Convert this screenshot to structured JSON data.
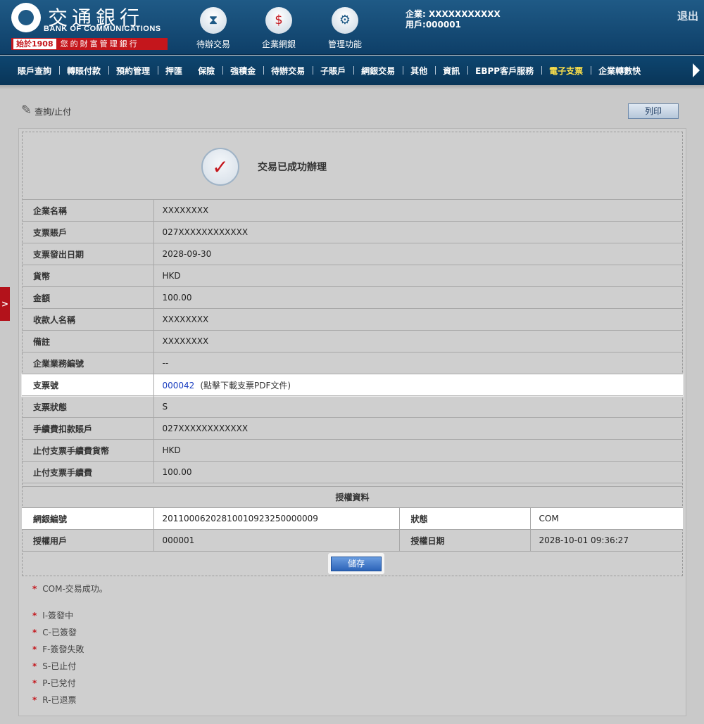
{
  "header": {
    "logo": {
      "cn": "交通銀行",
      "en": "BANK OF COMMUNICATIONS",
      "since": "始於1908",
      "slogan": "您的財富管理銀行"
    },
    "top_nav": [
      {
        "label": "待辦交易",
        "icon": "hourglass-icon"
      },
      {
        "label": "企業網銀",
        "icon": "monitor-dollar-icon"
      },
      {
        "label": "管理功能",
        "icon": "gears-icon"
      }
    ],
    "user": {
      "company_label": "企業:",
      "company": "XXXXXXXXXXX",
      "user_label": "用戶:",
      "user_id": "000001"
    },
    "logout": "退出"
  },
  "menu": {
    "items": [
      "賬戶查詢",
      "轉賬付款",
      "預約管理",
      "押匯",
      "保險",
      "強積金",
      "待辦交易",
      "子賬戶",
      "網銀交易",
      "其他",
      "資訊",
      "EBPP客戶服務",
      "電子支票",
      "企業轉數快"
    ],
    "active_index": 12,
    "active_color": "#ffe24a"
  },
  "side_tab": {
    "label": ">"
  },
  "page": {
    "title": "查詢/止付",
    "print_label": "列印",
    "success_message": "交易已成功辦理"
  },
  "details": [
    {
      "label": "企業名稱",
      "value": "XXXXXXXX"
    },
    {
      "label": "支票賬戶",
      "value": "027XXXXXXXXXXXX"
    },
    {
      "label": "支票發出日期",
      "value": "2028-09-30"
    },
    {
      "label": "貨幣",
      "value": "HKD"
    },
    {
      "label": "金額",
      "value": "100.00"
    },
    {
      "label": "收款人名稱",
      "value": "XXXXXXXX"
    },
    {
      "label": "備註",
      "value": "XXXXXXXX"
    },
    {
      "label": "企業業務編號",
      "value": "--"
    },
    {
      "label": "支票號",
      "value": "000042",
      "note": "(點擊下載支票PDF文件)"
    },
    {
      "label": "支票狀態",
      "value": "S"
    },
    {
      "label": "手續費扣款賬戶",
      "value": "027XXXXXXXXXXXX"
    },
    {
      "label": "止付支票手續費貨幣",
      "value": "HKD"
    },
    {
      "label": "止付支票手續費",
      "value": "100.00"
    }
  ],
  "authorization": {
    "heading": "授權資料",
    "rows": [
      {
        "label1": "網銀編號",
        "value1": "20110006202810010923250000009",
        "label2": "狀態",
        "value2": "COM"
      },
      {
        "label1": "授權用戶",
        "value1": "000001",
        "label2": "授權日期",
        "value2": "2028-10-01 09:36:27"
      }
    ]
  },
  "save_label": "儲存",
  "legend": [
    "COM-交易成功。",
    "I-簽發中",
    "C-已簽發",
    "F-簽發失敗",
    "S-已止付",
    "P-已兌付",
    "R-已退票"
  ]
}
